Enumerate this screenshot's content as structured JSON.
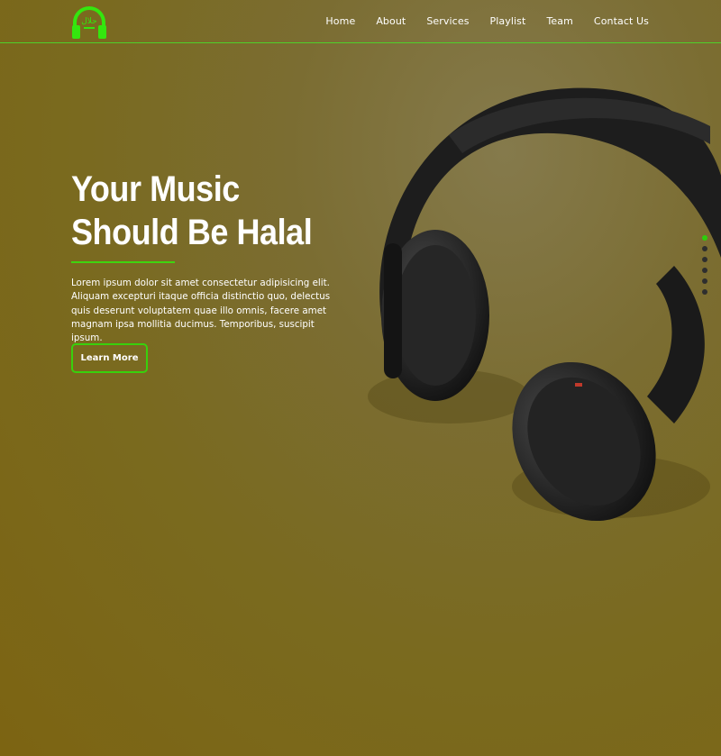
{
  "nav": {
    "logo_text": "حلال",
    "items": [
      {
        "label": "Home"
      },
      {
        "label": "About"
      },
      {
        "label": "Services"
      },
      {
        "label": "Playlist"
      },
      {
        "label": "Team"
      },
      {
        "label": "Contact Us"
      }
    ]
  },
  "hero": {
    "title": "Your Music Should Be Halal",
    "text": "Lorem ipsum dolor sit amet consectetur adipisicing elit. Aliquam excepturi itaque officia distinctio quo, delectus quis deserunt voluptatem quae illo omnis, facere amet magnam ipsa mollitia ducimus. Temporibus, suscipit ipsum.",
    "button_label": "Learn More"
  },
  "slider": {
    "slide_count": 6,
    "active_index": 0
  },
  "colors": {
    "accent": "#3fd40f",
    "background": "#7a6a1f",
    "text": "#ffffff"
  }
}
